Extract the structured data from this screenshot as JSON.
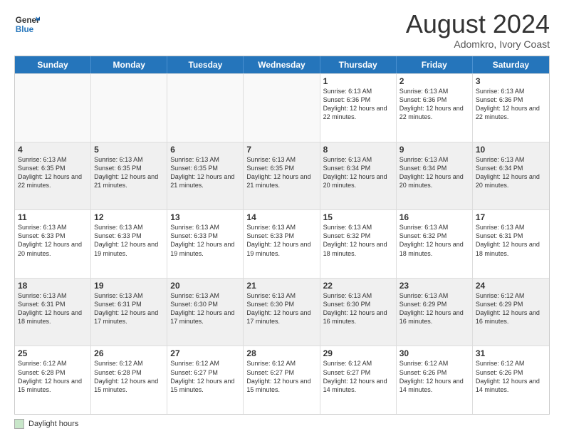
{
  "logo": {
    "line1": "General",
    "line2": "Blue"
  },
  "title": "August 2024",
  "location": "Adomkro, Ivory Coast",
  "days_header": [
    "Sunday",
    "Monday",
    "Tuesday",
    "Wednesday",
    "Thursday",
    "Friday",
    "Saturday"
  ],
  "footer_legend": "Daylight hours",
  "weeks": [
    [
      {
        "day": "",
        "info": ""
      },
      {
        "day": "",
        "info": ""
      },
      {
        "day": "",
        "info": ""
      },
      {
        "day": "",
        "info": ""
      },
      {
        "day": "1",
        "info": "Sunrise: 6:13 AM\nSunset: 6:36 PM\nDaylight: 12 hours\nand 22 minutes."
      },
      {
        "day": "2",
        "info": "Sunrise: 6:13 AM\nSunset: 6:36 PM\nDaylight: 12 hours\nand 22 minutes."
      },
      {
        "day": "3",
        "info": "Sunrise: 6:13 AM\nSunset: 6:36 PM\nDaylight: 12 hours\nand 22 minutes."
      }
    ],
    [
      {
        "day": "4",
        "info": "Sunrise: 6:13 AM\nSunset: 6:35 PM\nDaylight: 12 hours\nand 22 minutes."
      },
      {
        "day": "5",
        "info": "Sunrise: 6:13 AM\nSunset: 6:35 PM\nDaylight: 12 hours\nand 21 minutes."
      },
      {
        "day": "6",
        "info": "Sunrise: 6:13 AM\nSunset: 6:35 PM\nDaylight: 12 hours\nand 21 minutes."
      },
      {
        "day": "7",
        "info": "Sunrise: 6:13 AM\nSunset: 6:35 PM\nDaylight: 12 hours\nand 21 minutes."
      },
      {
        "day": "8",
        "info": "Sunrise: 6:13 AM\nSunset: 6:34 PM\nDaylight: 12 hours\nand 20 minutes."
      },
      {
        "day": "9",
        "info": "Sunrise: 6:13 AM\nSunset: 6:34 PM\nDaylight: 12 hours\nand 20 minutes."
      },
      {
        "day": "10",
        "info": "Sunrise: 6:13 AM\nSunset: 6:34 PM\nDaylight: 12 hours\nand 20 minutes."
      }
    ],
    [
      {
        "day": "11",
        "info": "Sunrise: 6:13 AM\nSunset: 6:33 PM\nDaylight: 12 hours\nand 20 minutes."
      },
      {
        "day": "12",
        "info": "Sunrise: 6:13 AM\nSunset: 6:33 PM\nDaylight: 12 hours\nand 19 minutes."
      },
      {
        "day": "13",
        "info": "Sunrise: 6:13 AM\nSunset: 6:33 PM\nDaylight: 12 hours\nand 19 minutes."
      },
      {
        "day": "14",
        "info": "Sunrise: 6:13 AM\nSunset: 6:33 PM\nDaylight: 12 hours\nand 19 minutes."
      },
      {
        "day": "15",
        "info": "Sunrise: 6:13 AM\nSunset: 6:32 PM\nDaylight: 12 hours\nand 18 minutes."
      },
      {
        "day": "16",
        "info": "Sunrise: 6:13 AM\nSunset: 6:32 PM\nDaylight: 12 hours\nand 18 minutes."
      },
      {
        "day": "17",
        "info": "Sunrise: 6:13 AM\nSunset: 6:31 PM\nDaylight: 12 hours\nand 18 minutes."
      }
    ],
    [
      {
        "day": "18",
        "info": "Sunrise: 6:13 AM\nSunset: 6:31 PM\nDaylight: 12 hours\nand 18 minutes."
      },
      {
        "day": "19",
        "info": "Sunrise: 6:13 AM\nSunset: 6:31 PM\nDaylight: 12 hours\nand 17 minutes."
      },
      {
        "day": "20",
        "info": "Sunrise: 6:13 AM\nSunset: 6:30 PM\nDaylight: 12 hours\nand 17 minutes."
      },
      {
        "day": "21",
        "info": "Sunrise: 6:13 AM\nSunset: 6:30 PM\nDaylight: 12 hours\nand 17 minutes."
      },
      {
        "day": "22",
        "info": "Sunrise: 6:13 AM\nSunset: 6:30 PM\nDaylight: 12 hours\nand 16 minutes."
      },
      {
        "day": "23",
        "info": "Sunrise: 6:13 AM\nSunset: 6:29 PM\nDaylight: 12 hours\nand 16 minutes."
      },
      {
        "day": "24",
        "info": "Sunrise: 6:12 AM\nSunset: 6:29 PM\nDaylight: 12 hours\nand 16 minutes."
      }
    ],
    [
      {
        "day": "25",
        "info": "Sunrise: 6:12 AM\nSunset: 6:28 PM\nDaylight: 12 hours\nand 15 minutes."
      },
      {
        "day": "26",
        "info": "Sunrise: 6:12 AM\nSunset: 6:28 PM\nDaylight: 12 hours\nand 15 minutes."
      },
      {
        "day": "27",
        "info": "Sunrise: 6:12 AM\nSunset: 6:27 PM\nDaylight: 12 hours\nand 15 minutes."
      },
      {
        "day": "28",
        "info": "Sunrise: 6:12 AM\nSunset: 6:27 PM\nDaylight: 12 hours\nand 15 minutes."
      },
      {
        "day": "29",
        "info": "Sunrise: 6:12 AM\nSunset: 6:27 PM\nDaylight: 12 hours\nand 14 minutes."
      },
      {
        "day": "30",
        "info": "Sunrise: 6:12 AM\nSunset: 6:26 PM\nDaylight: 12 hours\nand 14 minutes."
      },
      {
        "day": "31",
        "info": "Sunrise: 6:12 AM\nSunset: 6:26 PM\nDaylight: 12 hours\nand 14 minutes."
      }
    ]
  ]
}
